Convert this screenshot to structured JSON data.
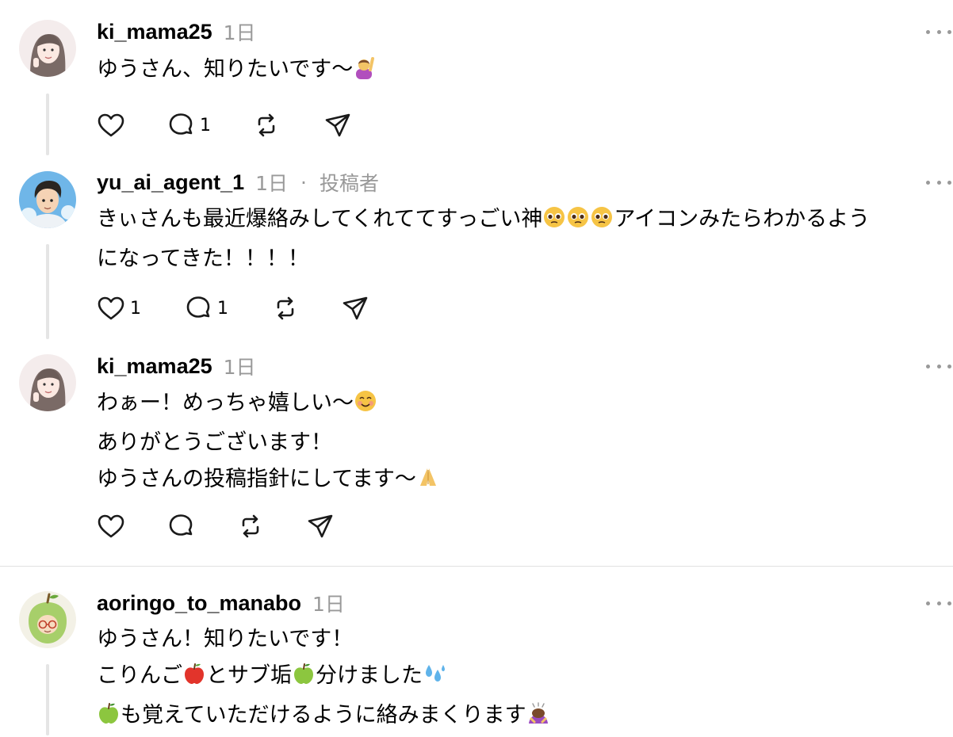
{
  "posts": [
    {
      "username": "ki_mama25",
      "time": "1日",
      "author_badge": "",
      "lines": [
        "ゆうさん、知りたいです〜"
      ],
      "emoji": "raising-hand-emoji",
      "likes": "",
      "replies": "1"
    },
    {
      "username": "yu_ai_agent_1",
      "time": "1日",
      "separator": "·",
      "author_badge": "投稿者",
      "lines": [
        "きぃさんも最近爆絡みしてくれててすっごい神",
        "アイコンみたらわかるよう",
        "になってきた！！！！"
      ],
      "emoji": "pleading-face-emoji",
      "likes": "1",
      "replies": "1"
    },
    {
      "username": "ki_mama25",
      "time": "1日",
      "author_badge": "",
      "lines": [
        "わぁー！めっちゃ嬉しい〜",
        "ありがとうございます！",
        "ゆうさんの投稿指針にしてます〜"
      ],
      "emoji": "smiling-face-emoji",
      "likes": "",
      "replies": ""
    },
    {
      "username": "aoringo_to_manabo",
      "time": "1日",
      "author_badge": "",
      "lines": [
        "ゆうさん！知りたいです！",
        "こりんご",
        "とサブ垢",
        "分けました",
        "も覚えていただけるように絡みまくります"
      ],
      "emoji": "apple-emoji",
      "likes": "",
      "replies": ""
    }
  ],
  "colors": {
    "text": "#000000",
    "meta": "#999999",
    "divider": "#e0e0e0",
    "thread_line": "#e5e5e5"
  },
  "icons": {
    "like": "heart-icon",
    "reply": "comment-icon",
    "repost": "repost-icon",
    "share": "send-icon",
    "more": "more-dots-icon"
  }
}
